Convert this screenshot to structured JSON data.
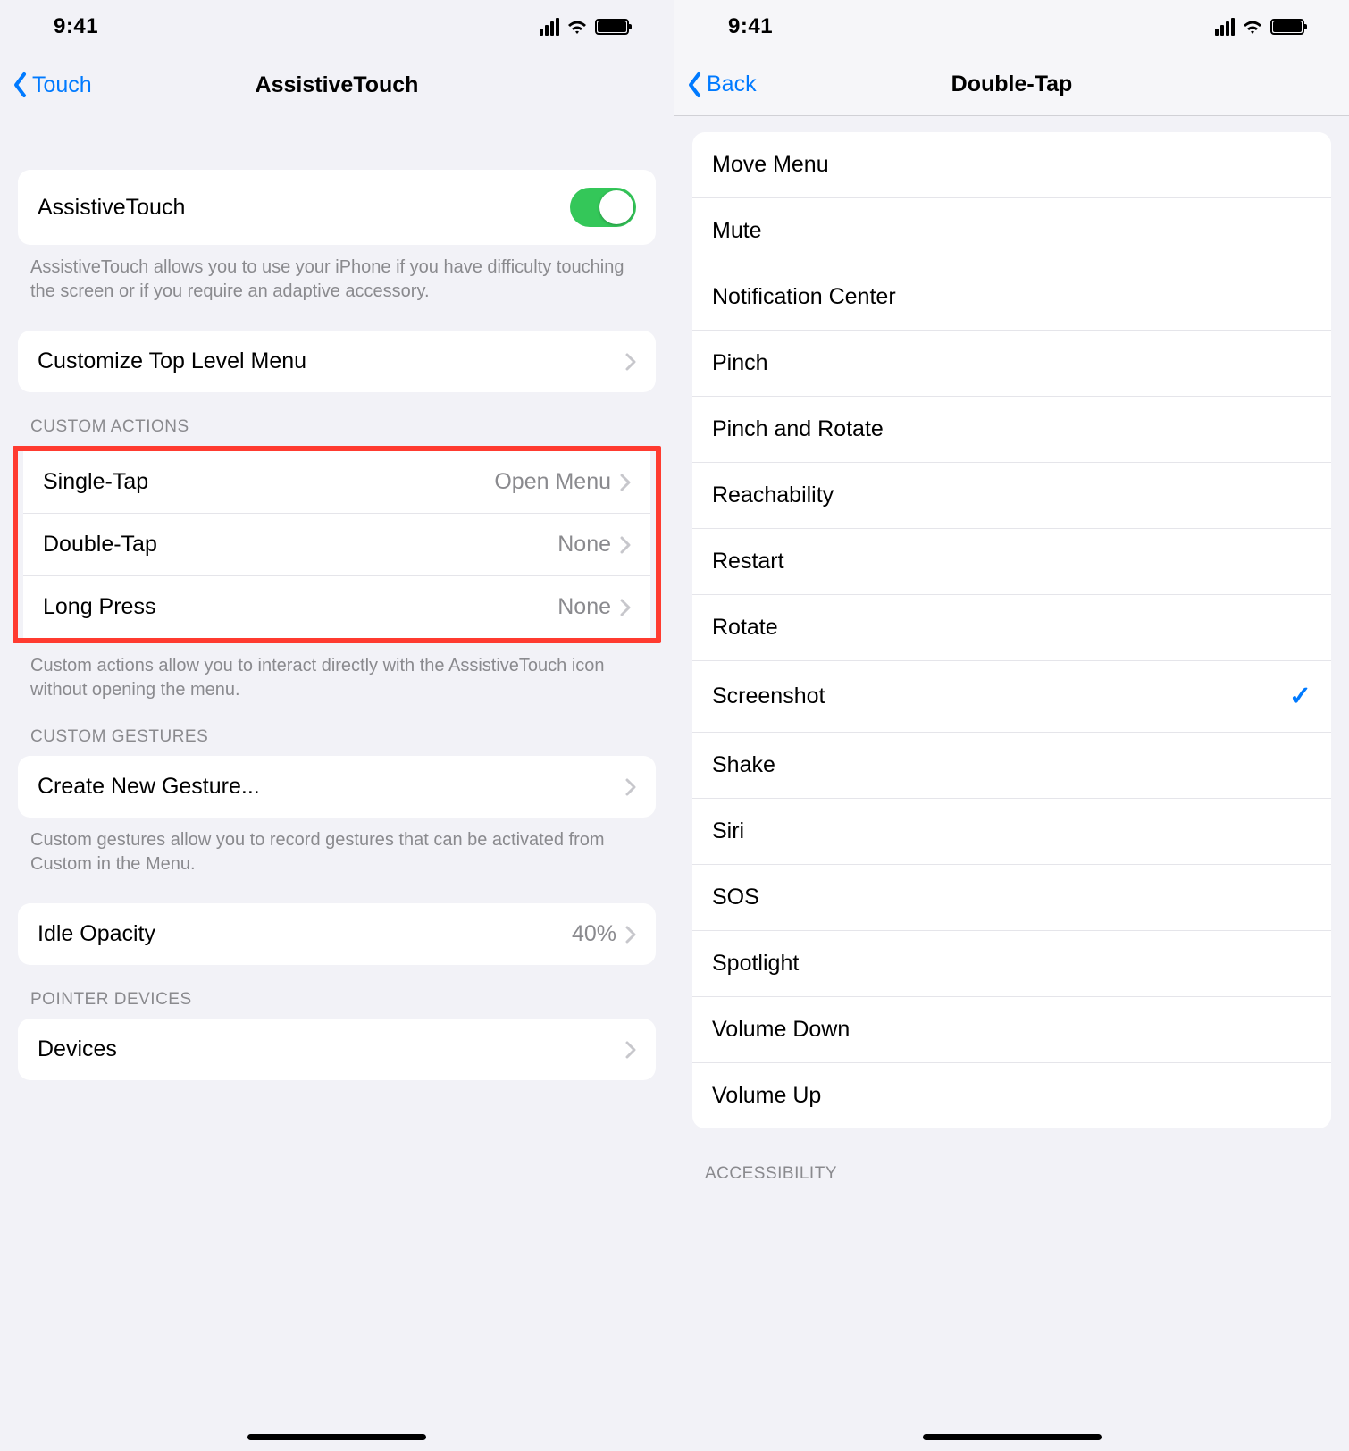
{
  "status": {
    "time": "9:41"
  },
  "left": {
    "back_label": "Touch",
    "title": "AssistiveTouch",
    "toggle": {
      "label": "AssistiveTouch",
      "on": true
    },
    "toggle_footer": "AssistiveTouch allows you to use your iPhone if you have difficulty touching the screen or if you require an adaptive accessory.",
    "customize_label": "Customize Top Level Menu",
    "custom_actions": {
      "header": "CUSTOM ACTIONS",
      "rows": [
        {
          "label": "Single-Tap",
          "value": "Open Menu"
        },
        {
          "label": "Double-Tap",
          "value": "None"
        },
        {
          "label": "Long Press",
          "value": "None"
        }
      ],
      "footer": "Custom actions allow you to interact directly with the AssistiveTouch icon without opening the menu."
    },
    "custom_gestures": {
      "header": "CUSTOM GESTURES",
      "row_label": "Create New Gesture...",
      "footer": "Custom gestures allow you to record gestures that can be activated from Custom in the Menu."
    },
    "idle_opacity": {
      "label": "Idle Opacity",
      "value": "40%"
    },
    "pointer_devices": {
      "header": "POINTER DEVICES",
      "row_label": "Devices"
    }
  },
  "right": {
    "back_label": "Back",
    "title": "Double-Tap",
    "options": [
      {
        "label": "Move Menu",
        "selected": false
      },
      {
        "label": "Mute",
        "selected": false
      },
      {
        "label": "Notification Center",
        "selected": false
      },
      {
        "label": "Pinch",
        "selected": false
      },
      {
        "label": "Pinch and Rotate",
        "selected": false
      },
      {
        "label": "Reachability",
        "selected": false
      },
      {
        "label": "Restart",
        "selected": false
      },
      {
        "label": "Rotate",
        "selected": false
      },
      {
        "label": "Screenshot",
        "selected": true
      },
      {
        "label": "Shake",
        "selected": false
      },
      {
        "label": "Siri",
        "selected": false
      },
      {
        "label": "SOS",
        "selected": false
      },
      {
        "label": "Spotlight",
        "selected": false
      },
      {
        "label": "Volume Down",
        "selected": false
      },
      {
        "label": "Volume Up",
        "selected": false
      }
    ],
    "next_header": "ACCESSIBILITY"
  }
}
